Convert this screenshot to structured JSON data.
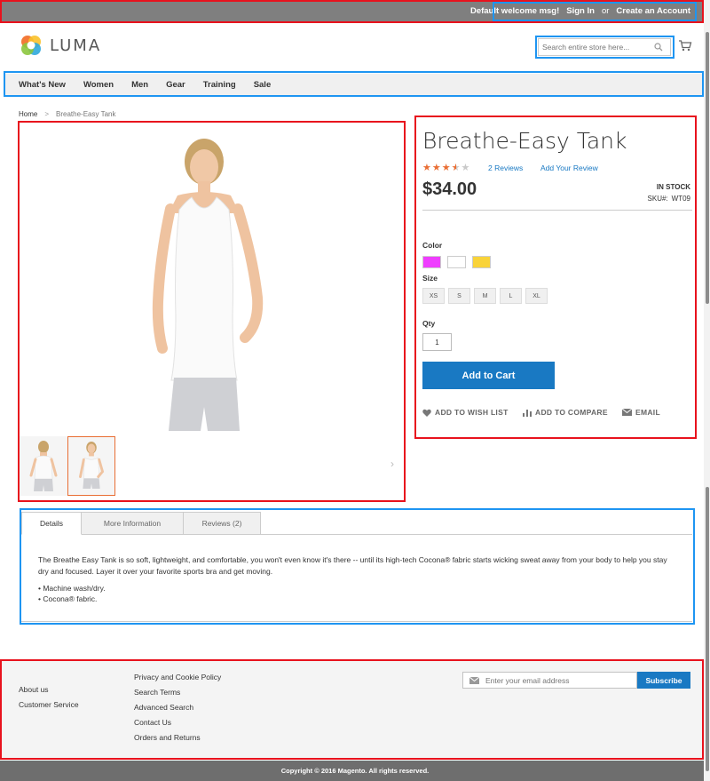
{
  "header": {
    "welcome": "Default welcome msg!",
    "sign_in": "Sign In",
    "or": "or",
    "create_account": "Create an Account",
    "logo_text": "LUMA",
    "search_placeholder": "Search entire store here..."
  },
  "nav": {
    "items": [
      "What's New",
      "Women",
      "Men",
      "Gear",
      "Training",
      "Sale"
    ]
  },
  "breadcrumb": {
    "home": "Home",
    "separator": ">",
    "current": "Breathe-Easy Tank"
  },
  "product": {
    "title": "Breathe-Easy Tank",
    "rating": {
      "stars": 5,
      "filled": 3.5
    },
    "reviews_link": "2 Reviews",
    "add_review_link": "Add Your Review",
    "price": "$34.00",
    "stock": "IN STOCK",
    "sku_label": "SKU#:",
    "sku": "WT09",
    "color_label": "Color",
    "colors": [
      "#ef3dff",
      "#ffffff",
      "#f9d339"
    ],
    "size_label": "Size",
    "sizes": [
      "XS",
      "S",
      "M",
      "L",
      "XL"
    ],
    "qty_label": "Qty",
    "qty": "1",
    "add_to_cart": "Add to Cart",
    "add_to_wishlist": "ADD TO WISH LIST",
    "add_to_compare": "ADD TO COMPARE",
    "email": "EMAIL"
  },
  "tabs": {
    "items": [
      "Details",
      "More Information",
      "Reviews (2)"
    ],
    "description": "The Breathe Easy Tank is so soft, lightweight, and comfortable, you won't even know it's there -- until its high-tech Cocona® fabric starts wicking sweat away from your body to help you stay dry and focused. Layer it over your favorite sports bra and get moving.",
    "bullets": [
      "• Machine wash/dry.",
      "• Cocona® fabric."
    ]
  },
  "footer": {
    "col1": [
      "About us",
      "Customer Service"
    ],
    "col2": [
      "Privacy and Cookie Policy",
      "Search Terms",
      "Advanced Search",
      "Contact Us",
      "Orders and Returns"
    ],
    "newsletter_placeholder": "Enter your email address",
    "subscribe": "Subscribe",
    "copyright": "Copyright © 2016 Magento. All rights reserved."
  },
  "colors": {
    "accent": "#1979c3",
    "star": "#e96e34",
    "annotation_red": "#e8121d",
    "annotation_blue": "#1e95f2"
  }
}
